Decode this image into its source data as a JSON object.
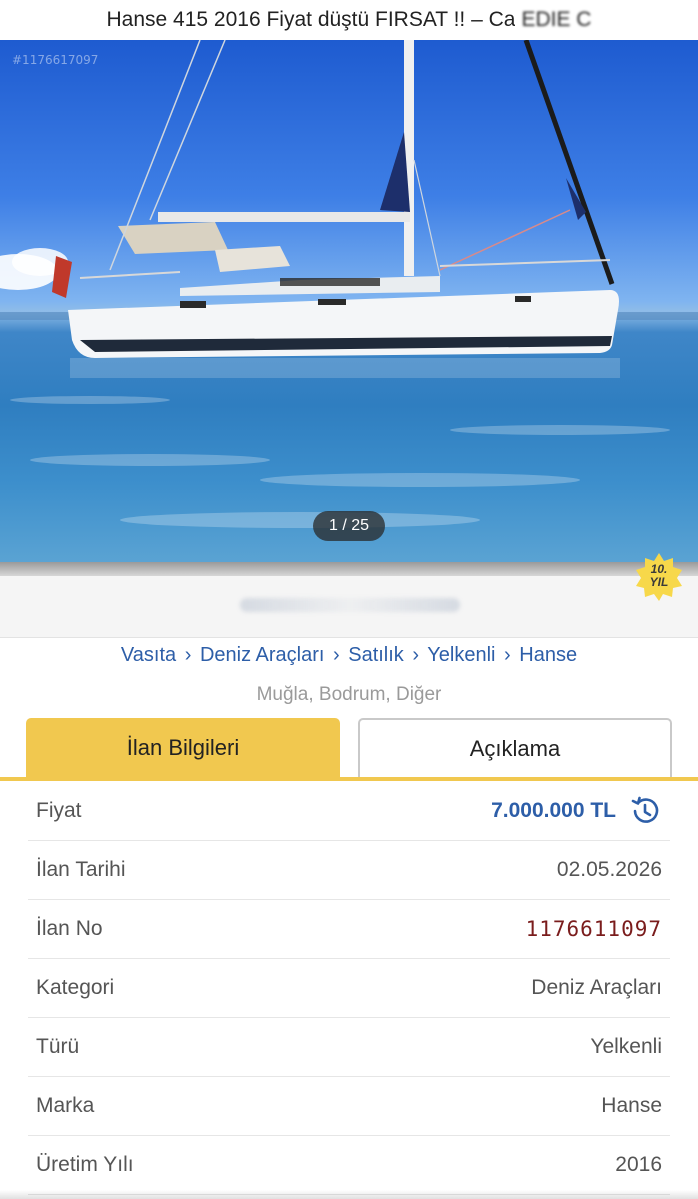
{
  "header": {
    "title": "Hanse 415 2016 Fiyat düştü FIRSAT !! – Ca",
    "title_suffix": "EDIE C"
  },
  "photo": {
    "watermark": "#1176617097",
    "counter": "1 / 25"
  },
  "badge": {
    "line1": "10.",
    "line2": "YIL",
    "color": "#f7d84a"
  },
  "breadcrumb": {
    "items": [
      "Vasıta",
      "Deniz Araçları",
      "Satılık",
      "Yelkenli",
      "Hanse"
    ],
    "separator": "›"
  },
  "location": "Muğla, Bodrum, Diğer",
  "tabs": {
    "info_label": "İlan Bilgileri",
    "description_label": "Açıklama",
    "active": "info"
  },
  "details": {
    "price_label": "Fiyat",
    "price_value": "7.000.000 TL",
    "date_label": "İlan Tarihi",
    "date_value": "02.05.2026",
    "number_label": "İlan No",
    "number_value": "1176611097",
    "category_label": "Kategori",
    "category_value": "Deniz Araçları",
    "type_label": "Türü",
    "type_value": "Yelkenli",
    "brand_label": "Marka",
    "brand_value": "Hanse",
    "year_label": "Üretim Yılı",
    "year_value": "2016"
  },
  "colors": {
    "accent_yellow": "#f1c84f",
    "link_blue": "#2d5ea8",
    "listing_no_red": "#7a1c1c"
  },
  "icons": {
    "price_history": "history-icon"
  }
}
